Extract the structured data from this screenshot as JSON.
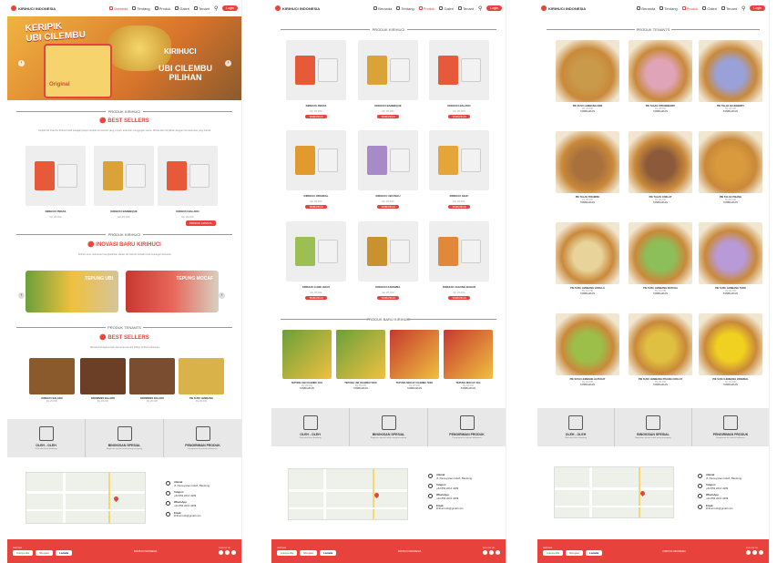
{
  "nav": {
    "brand": "KIRIHUCI INDONESIA",
    "items": [
      "Beranda",
      "Tentang",
      "Produk",
      "Galeri",
      "Tenant"
    ],
    "login": "Login"
  },
  "hero": {
    "title1": "KERIPIK",
    "title2": "UBI CILEMBU",
    "badge": "KIRIHUCI",
    "sub1": "UBI CILEMBU",
    "sub2": "PILIHAN",
    "bag_label": "Original"
  },
  "sections": {
    "produk_kirihuci": "PRODUK KIRIHUCI",
    "best_sellers": "BEST SELLERS",
    "inovasi": "INOVASI BARU KIRIHUCI",
    "produk_tenants": "PRODUK TENANTS",
    "produk_baru": "PRODUK BARU KIRIHUCI",
    "produk_tenants_upper": "PRODUK TENANTS"
  },
  "texts": {
    "desc1": "Keripik Ubi Cilembu Kirihuci hadir sebagai pelopor keripik ubi cilembu yang renyah, lezat dan menggugah selera. Dibuat dari ubi pilihan dengan cita rasa khas yang otentik.",
    "desc2": "Kirihuci terus berinovasi menghadirkan olahan ubi cilembu terbaik untuk keluarga Indonesia.",
    "desc3": "Nikmati berbagai produk dari tenant-tenant pilihan Kirihuci Indonesia."
  },
  "buttons": {
    "more_products": "PRODUK LAINNYA",
    "add_cart": "TAMBAHKAN"
  },
  "p1_products": [
    {
      "name": "KIRIHUCI PEDAS",
      "price": "Rp 25.000"
    },
    {
      "name": "KIRIHUCI BARBEQUE",
      "price": "Rp 25.000"
    },
    {
      "name": "KIRIHUCI BALADO",
      "price": "Rp 25.000"
    }
  ],
  "banners": [
    {
      "title": "TEPUNG UBI"
    },
    {
      "title": "TEPUNG MOCAF"
    }
  ],
  "p1_tenants": [
    {
      "name": "KIRIHUCI BALADO",
      "price": "Rp 25.000"
    },
    {
      "name": "BROWNIES BALADO",
      "price": "Rp 45.000"
    },
    {
      "name": "BROWNIES BALADO",
      "price": "Rp 45.000"
    },
    {
      "name": "PIE SUSU LEMBANG",
      "price": "Rp 30.000"
    }
  ],
  "features": [
    {
      "title": "OLEH - OLEH",
      "sub": "Oleh-oleh khas Bandung"
    },
    {
      "title": "BINGKISAN SPESIAL",
      "sub": "Bingkisan spesial untuk orang tersayang"
    },
    {
      "title": "PENGIRIMAN PRODUK",
      "sub": "Pengiriman ke seluruh Indonesia"
    }
  ],
  "contact": [
    {
      "label": "Alamat",
      "value": "Jl. Pamoyanan Indah, Bandung"
    },
    {
      "label": "Telepon",
      "value": "+62 852 2212 4409"
    },
    {
      "label": "WhatsApp",
      "value": "+62 852 2212 4409"
    },
    {
      "label": "Email",
      "value": "kirihuci.info@gmail.com"
    }
  ],
  "footer": {
    "partner_label": "PARTNER",
    "partners": [
      "tokopedia",
      "Shopee",
      "Lazada"
    ],
    "copyright": "KIRIHUCI INDONESIA",
    "follow": "FOLLOW US"
  },
  "p2_products": [
    {
      "name": "KIRIHUCI PEDAS",
      "price": "Rp 25.000"
    },
    {
      "name": "KIRIHUCI BARBEQUE",
      "price": "Rp 25.000"
    },
    {
      "name": "KIRIHUCI BALADO",
      "price": "Rp 25.000"
    },
    {
      "name": "KIRIHUCI ORIGINAL",
      "price": "Rp 25.000"
    },
    {
      "name": "KIRIHUCI UBI UNGU",
      "price": "Rp 25.000"
    },
    {
      "name": "KIRIHUCI KEJU",
      "price": "Rp 25.000"
    },
    {
      "name": "KIRIHUCI CABE HIJAU",
      "price": "Rp 25.000"
    },
    {
      "name": "KIRIHUCI KARAMEL",
      "price": "Rp 25.000"
    },
    {
      "name": "KIRIHUCI JAGUNG BAKAR",
      "price": "Rp 25.000"
    }
  ],
  "p2_new": [
    {
      "name": "TEPUNG UBI CILEMBU 1KG",
      "price": "Rp 45.000"
    },
    {
      "name": "TEPUNG UBI CILEMBU 500G",
      "price": "Rp 25.000"
    },
    {
      "name": "TEPUNG MOCAF CILEMBU 500G",
      "price": "Rp 25.000"
    },
    {
      "name": "TEPUNG MOCAF 1KG",
      "price": "Rp 45.000"
    }
  ],
  "p3_tenants": [
    {
      "name": "PIE SUSU LEMBANG KIWI",
      "price": "Rp 30.000"
    },
    {
      "name": "PIE TALAS STRAWBERRY",
      "price": "Rp 30.000"
    },
    {
      "name": "PIE TALAS BLUEBERRY",
      "price": "Rp 30.000"
    },
    {
      "name": "PIE TALAS TIRAMISU",
      "price": "Rp 30.000"
    },
    {
      "name": "PIE TALAS COKLAT",
      "price": "Rp 30.000"
    },
    {
      "name": "PIE TALAS PISANG",
      "price": "Rp 30.000"
    },
    {
      "name": "PIE SUSU LEMBANG VANILLA",
      "price": "Rp 30.000"
    },
    {
      "name": "PIE SUSU LEMBANG MATCHA",
      "price": "Rp 30.000"
    },
    {
      "name": "PIE SUSU LEMBANG TARO",
      "price": "Rp 30.000"
    },
    {
      "name": "PIE SUSU LEMBANG ALPUKAT",
      "price": "Rp 30.000"
    },
    {
      "name": "PIE SUSU LEMBANG PISANG COKLAT",
      "price": "Rp 30.000"
    },
    {
      "name": "PIE SUSU LEMBANG ORIGINAL",
      "price": "Rp 30.000"
    }
  ],
  "colors": {
    "accent": "#e8423c"
  }
}
